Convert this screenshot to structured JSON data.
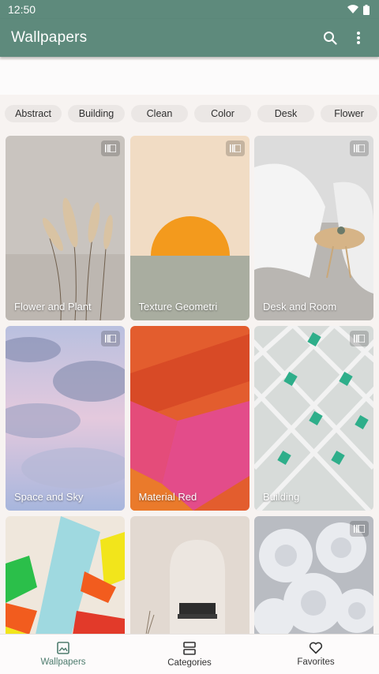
{
  "status_bar": {
    "time": "12:50"
  },
  "app_bar": {
    "title": "Wallpapers"
  },
  "chips": [
    "Abstract",
    "Building",
    "Clean",
    "Color",
    "Desk",
    "Flower"
  ],
  "wallpapers": [
    {
      "title": "Flower and Plant"
    },
    {
      "title": "Texture Geometri"
    },
    {
      "title": "Desk and Room"
    },
    {
      "title": "Space and Sky"
    },
    {
      "title": "Material Red"
    },
    {
      "title": "Building"
    },
    {
      "title": ""
    },
    {
      "title": ""
    },
    {
      "title": ""
    }
  ],
  "bottom_nav": [
    {
      "label": "Wallpapers",
      "icon": "image-icon",
      "active": true
    },
    {
      "label": "Categories",
      "icon": "categories-icon",
      "active": false
    },
    {
      "label": "Favorites",
      "icon": "heart-icon",
      "active": false
    }
  ],
  "colors": {
    "primary": "#5e8a7c",
    "active_nav": "#4e7c6e"
  }
}
